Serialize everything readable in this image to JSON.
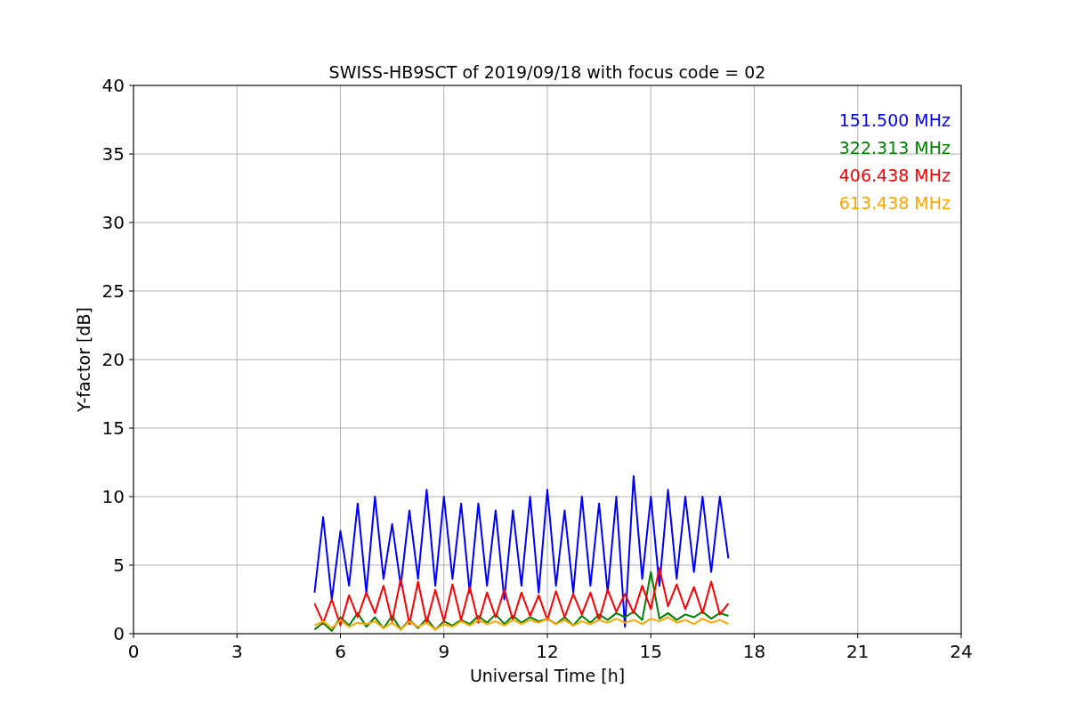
{
  "chart_data": {
    "type": "line",
    "title": "SWISS-HB9SCT of 2019/09/18 with focus code = 02",
    "xlabel": "Universal Time [h]",
    "ylabel": "Y-factor [dB]",
    "x": [
      5.25,
      5.5,
      5.75,
      6,
      6.25,
      6.5,
      6.75,
      7,
      7.25,
      7.5,
      7.75,
      8,
      8.25,
      8.5,
      8.75,
      9,
      9.25,
      9.5,
      9.75,
      10,
      10.25,
      10.5,
      10.75,
      11,
      11.25,
      11.5,
      11.75,
      12,
      12.25,
      12.5,
      12.75,
      13,
      13.25,
      13.5,
      13.75,
      14,
      14.25,
      14.5,
      14.75,
      15,
      15.25,
      15.5,
      15.75,
      16,
      16.25,
      16.5,
      16.75,
      17,
      17.25
    ],
    "series": [
      {
        "name": "151.500 MHz",
        "color": "#0000ff",
        "values": [
          3,
          8.5,
          2.5,
          7.5,
          3.5,
          9.5,
          3,
          10,
          4,
          8,
          3.5,
          9,
          4,
          10.5,
          3.5,
          10,
          4,
          9.5,
          3,
          9.5,
          3.5,
          9,
          2.5,
          9,
          3.5,
          10,
          3,
          10.5,
          3.5,
          9,
          3,
          10,
          3.5,
          9.5,
          3,
          10,
          0.5,
          11.5,
          4,
          10,
          3.5,
          10.5,
          4,
          10,
          4.5,
          10,
          4.5,
          10,
          5.5
        ]
      },
      {
        "name": "322.313 MHz",
        "color": "#008000",
        "values": [
          0.3,
          0.8,
          0.2,
          1.2,
          0.6,
          1.5,
          0.5,
          1.2,
          0.4,
          1.3,
          0.3,
          1.0,
          0.4,
          1.1,
          0.3,
          0.9,
          0.6,
          1.0,
          0.7,
          1.3,
          0.8,
          1.4,
          0.7,
          1.3,
          0.8,
          1.2,
          0.9,
          1.1,
          0.7,
          1.2,
          0.6,
          1.3,
          0.8,
          1.4,
          1.0,
          1.5,
          1.2,
          1.6,
          1.0,
          4.5,
          1.1,
          1.5,
          1.0,
          1.4,
          1.2,
          1.6,
          1.1,
          1.5,
          1.3
        ]
      },
      {
        "name": "406.438 MHz",
        "color": "#ff0000",
        "values": [
          2.2,
          0.8,
          2.5,
          0.6,
          2.8,
          1.2,
          3.0,
          1.5,
          3.5,
          0.9,
          4.0,
          0.7,
          3.8,
          0.8,
          3.2,
          0.9,
          3.6,
          1.0,
          3.4,
          0.8,
          3.0,
          1.2,
          3.2,
          1.0,
          3.0,
          1.3,
          2.8,
          1.0,
          3.1,
          1.2,
          2.9,
          1.4,
          3.0,
          1.0,
          3.2,
          1.6,
          2.9,
          1.5,
          3.5,
          1.8,
          4.8,
          2.0,
          3.6,
          1.8,
          3.4,
          1.5,
          3.8,
          1.4,
          2.2
        ]
      },
      {
        "name": "613.438 MHz",
        "color": "#ffa500",
        "values": [
          0.6,
          0.9,
          0.4,
          1.0,
          0.5,
          0.8,
          0.7,
          0.9,
          0.4,
          0.8,
          0.3,
          0.9,
          0.5,
          0.8,
          0.3,
          0.7,
          0.5,
          0.9,
          0.6,
          1.0,
          0.7,
          0.9,
          0.6,
          1.0,
          0.7,
          1.0,
          0.8,
          1.1,
          0.7,
          1.0,
          0.6,
          0.9,
          0.7,
          1.0,
          0.8,
          1.1,
          0.8,
          1.0,
          0.7,
          1.1,
          0.9,
          1.2,
          0.8,
          1.0,
          0.7,
          1.1,
          0.8,
          1.0,
          0.7
        ]
      }
    ],
    "xlim": [
      0,
      24
    ],
    "ylim": [
      0,
      40
    ],
    "xticks": [
      0,
      3,
      6,
      9,
      12,
      15,
      18,
      21,
      24
    ],
    "yticks": [
      0,
      5,
      10,
      15,
      20,
      25,
      30,
      35,
      40
    ],
    "grid": true
  }
}
